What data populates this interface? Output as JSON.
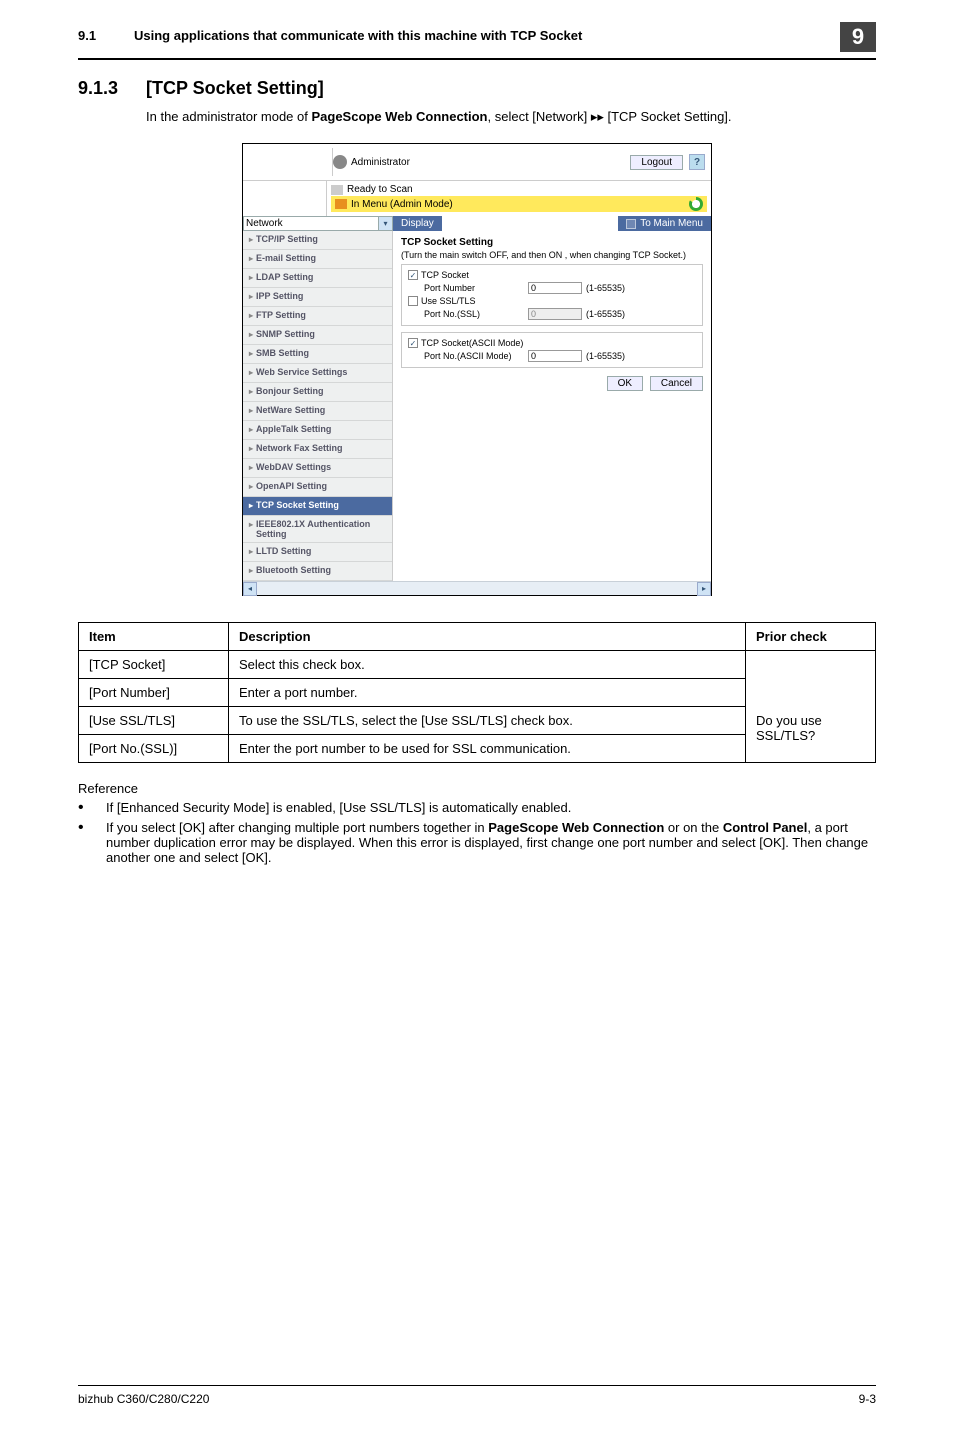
{
  "header": {
    "section_number": "9.1",
    "section_title": "Using applications that communicate with this machine with TCP Socket",
    "chapter_badge": "9"
  },
  "section": {
    "number": "9.1.3",
    "title": "[TCP Socket Setting]",
    "intro_pre": "In the administrator mode of ",
    "intro_bold1": "PageScope Web Connection",
    "intro_mid": ", select [Network] ",
    "intro_arrow": "▸▸",
    "intro_post": " [TCP Socket Setting]."
  },
  "screenshot": {
    "admin_label": "Administrator",
    "logout_btn": "Logout",
    "help_btn": "?",
    "status_ready": "Ready to Scan",
    "status_menu": "In Menu (Admin Mode)",
    "select_value": "Network",
    "display_btn": "Display",
    "to_main_btn": "To Main Menu",
    "nav": [
      "TCP/IP Setting",
      "E-mail Setting",
      "LDAP Setting",
      "IPP Setting",
      "FTP Setting",
      "SNMP Setting",
      "SMB Setting",
      "Web Service Settings",
      "Bonjour Setting",
      "NetWare Setting",
      "AppleTalk Setting",
      "Network Fax Setting",
      "WebDAV Settings",
      "OpenAPI Setting",
      "TCP Socket Setting",
      "IEEE802.1X Authentication Setting",
      "LLTD Setting",
      "Bluetooth Setting"
    ],
    "nav_active_index": 14,
    "content": {
      "title": "TCP Socket Setting",
      "note": "(Turn the main switch OFF, and then ON , when changing TCP Socket.)",
      "cb_tcp": "TCP Socket",
      "lbl_port": "Port Number",
      "val_port": "0",
      "range_port": "(1-65535)",
      "cb_ssl": "Use SSL/TLS",
      "lbl_portssl": "Port No.(SSL)",
      "val_portssl": "0",
      "range_portssl": "(1-65535)",
      "cb_ascii": "TCP Socket(ASCII Mode)",
      "lbl_portascii": "Port No.(ASCII Mode)",
      "val_portascii": "0",
      "range_portascii": "(1-65535)",
      "ok_btn": "OK",
      "cancel_btn": "Cancel"
    }
  },
  "desc_table": {
    "headers": {
      "item": "Item",
      "desc": "Description",
      "prior": "Prior check"
    },
    "rows": [
      {
        "item": "[TCP Socket]",
        "desc": "Select this check box.",
        "prior": ""
      },
      {
        "item": "[Port Number]",
        "desc": "Enter a port number.",
        "prior": ""
      },
      {
        "item": "[Use SSL/TLS]",
        "desc": "To use the SSL/TLS, select the [Use SSL/TLS] check box.",
        "prior": "Do you use SSL/TLS?"
      },
      {
        "item": "[Port No.(SSL)]",
        "desc": "Enter the port number to be used for SSL communication.",
        "prior": ""
      }
    ]
  },
  "reference": {
    "title": "Reference",
    "items": [
      {
        "text_pre": "If [Enhanced Security Mode] is enabled, [Use SSL/TLS] is automatically enabled."
      },
      {
        "text_pre": "If you select [OK] after changing multiple port numbers together in ",
        "bold1": "PageScope Web Connection",
        "mid1": " or on the ",
        "bold2": "Control Panel",
        "post": ", a port number duplication error may be displayed. When this error is displayed, first change one port number and select [OK]. Then change another one and select [OK]."
      }
    ]
  },
  "footer": {
    "left": "bizhub C360/C280/C220",
    "right": "9-3"
  }
}
